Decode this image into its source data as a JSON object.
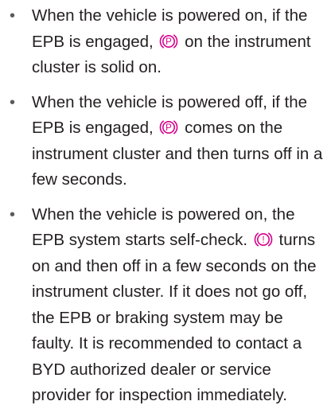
{
  "bullet_symbol": "•",
  "icon_color": "#d6008c",
  "items": [
    {
      "before_icon": "When the vehicle is powered on, if the EPB is engaged,",
      "icon": "parking-brake-icon",
      "icon_glyph": "P",
      "after_icon": "on the instrument cluster is solid on."
    },
    {
      "before_icon": "When the vehicle is powered off, if the EPB is engaged,",
      "icon": "parking-brake-icon",
      "icon_glyph": "P",
      "after_icon": "comes on the instrument cluster and then turns off in a few seconds."
    },
    {
      "before_icon": "When the vehicle is powered on, the EPB system starts self-check.",
      "icon": "brake-warning-icon",
      "icon_glyph": "!",
      "after_icon": "turns on and then off in a few seconds on the instrument cluster. If it does not go off, the EPB or braking system may be faulty. It is recommended to contact a BYD authorized dealer or service provider for inspection immediately."
    }
  ]
}
